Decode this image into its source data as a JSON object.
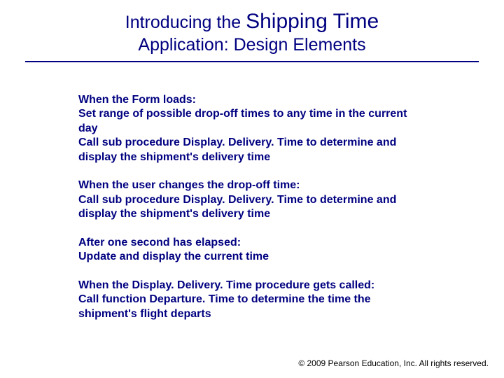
{
  "title": {
    "prefix": "Introducing the ",
    "emphasis": "Shipping Time",
    "line2": "Application: Design Elements"
  },
  "body": {
    "p1": {
      "l1": "When the Form loads:",
      "l2": "Set range of possible drop-off times to any time in the current day",
      "l3": "Call sub procedure Display. Delivery. Time to determine and display the shipment's delivery time"
    },
    "p2": {
      "l1": "When the user changes the drop-off time:",
      "l2": "Call sub procedure Display. Delivery. Time to determine and display the shipment's delivery time"
    },
    "p3": {
      "l1": "After one second has elapsed:",
      "l2": "Update and display the current time"
    },
    "p4": {
      "l1": "When the Display. Delivery. Time procedure gets called:",
      "l2": "Call function Departure. Time to determine the time the shipment's flight departs"
    }
  },
  "footer": {
    "copyright_symbol": "©",
    "text": " 2009 Pearson Education, Inc. All rights reserved."
  }
}
